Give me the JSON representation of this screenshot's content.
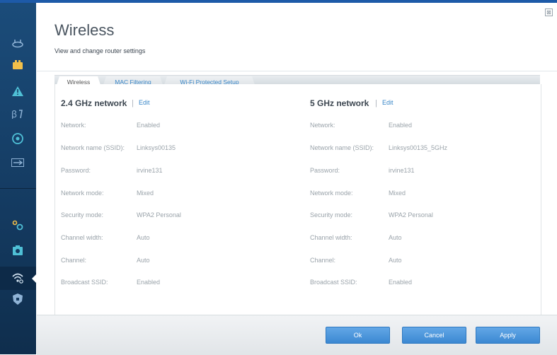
{
  "header": {
    "title": "Wireless",
    "subtitle": "View and change router settings",
    "close_symbol": "⊠"
  },
  "sidebar": {
    "items": [
      {
        "icon": "router-status-icon"
      },
      {
        "icon": "devices-icon"
      },
      {
        "icon": "alert-icon"
      },
      {
        "icon": "parental-icon"
      },
      {
        "icon": "speed-icon"
      },
      {
        "icon": "storage-icon"
      },
      {
        "icon": "connectivity-gears-icon"
      },
      {
        "icon": "troubleshooting-icon"
      },
      {
        "icon": "wireless-icon",
        "active": true
      },
      {
        "icon": "security-shield-icon"
      }
    ]
  },
  "tabs": [
    {
      "label": "Wireless",
      "active": true
    },
    {
      "label": "MAC Filtering",
      "active": false
    },
    {
      "label": "Wi-Fi Protected Setup",
      "active": false
    }
  ],
  "network_24": {
    "title": "2.4 GHz network",
    "separator": "|",
    "edit": "Edit",
    "rows": [
      {
        "label": "Network:",
        "value": "Enabled"
      },
      {
        "label": "Network name (SSID):",
        "value": "Linksys00135"
      },
      {
        "label": "Password:",
        "value": "irvine131"
      },
      {
        "label": "Network mode:",
        "value": "Mixed"
      },
      {
        "label": "Security mode:",
        "value": "WPA2 Personal"
      },
      {
        "label": "Channel width:",
        "value": "Auto"
      },
      {
        "label": "Channel:",
        "value": "Auto"
      },
      {
        "label": "Broadcast SSID:",
        "value": "Enabled"
      }
    ]
  },
  "network_5": {
    "title": "5 GHz network",
    "separator": "|",
    "edit": "Edit",
    "rows": [
      {
        "label": "Network:",
        "value": "Enabled"
      },
      {
        "label": "Network name (SSID):",
        "value": "Linksys00135_5GHz"
      },
      {
        "label": "Password:",
        "value": "irvine131"
      },
      {
        "label": "Network mode:",
        "value": "Mixed"
      },
      {
        "label": "Security mode:",
        "value": "WPA2 Personal"
      },
      {
        "label": "Channel width:",
        "value": "Auto"
      },
      {
        "label": "Channel:",
        "value": "Auto"
      },
      {
        "label": "Broadcast SSID:",
        "value": "Enabled"
      }
    ]
  },
  "footer": {
    "ok_label": "Ok",
    "cancel_label": "Cancel",
    "apply_label": "Apply"
  },
  "colors": {
    "accent": "#3a87c8",
    "sidebar": "#143a60",
    "button": "#4a94d8"
  }
}
